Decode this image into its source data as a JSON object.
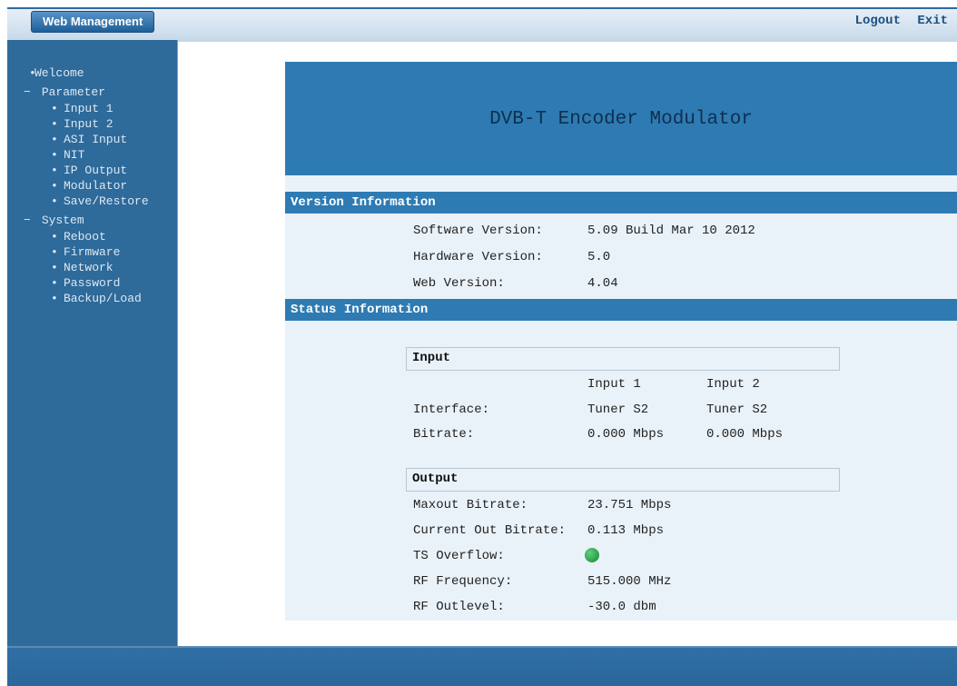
{
  "topbar": {
    "brand": "Web Management",
    "logout": "Logout",
    "exit": "Exit"
  },
  "sidebar": {
    "welcome": "Welcome",
    "parameter": {
      "label": "Parameter",
      "items": [
        "Input 1",
        "Input 2",
        "ASI Input",
        "NIT",
        "IP Output",
        "Modulator",
        "Save/Restore"
      ]
    },
    "system": {
      "label": "System",
      "items": [
        "Reboot",
        "Firmware",
        "Network",
        "Password",
        "Backup/Load"
      ]
    }
  },
  "header": {
    "title": "DVB-T Encoder Modulator"
  },
  "version": {
    "title": "Version Information",
    "software_label": "Software Version:",
    "software_value": "5.09 Build Mar 10 2012",
    "hardware_label": "Hardware Version:",
    "hardware_value": "5.0",
    "web_label": "Web Version:",
    "web_value": "4.04"
  },
  "status": {
    "title": "Status Information",
    "input": {
      "heading": "Input",
      "col1": "Input 1",
      "col2": "Input 2",
      "interface_label": "Interface:",
      "interface_1": "Tuner S2",
      "interface_2": "Tuner S2",
      "bitrate_label": "Bitrate:",
      "bitrate_1": "0.000 Mbps",
      "bitrate_2": "0.000 Mbps"
    },
    "output": {
      "heading": "Output",
      "maxout_label": "Maxout Bitrate:",
      "maxout_value": "23.751 Mbps",
      "current_label": "Current Out Bitrate:",
      "current_value": "0.113 Mbps",
      "overflow_label": "TS Overflow:",
      "overflow_color": "#2fa44e",
      "rf_freq_label": "RF Frequency:",
      "rf_freq_value": "515.000 MHz",
      "rf_level_label": "RF Outlevel:",
      "rf_level_value": "-30.0 dbm"
    }
  }
}
